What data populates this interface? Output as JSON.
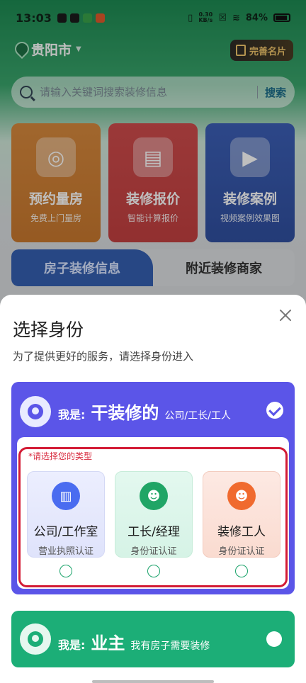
{
  "status": {
    "time": "13:03",
    "net_speed": "0.30",
    "net_unit": "KB/s",
    "battery": "84%"
  },
  "location": {
    "city": "贵阳市"
  },
  "header": {
    "profile_button": "完善名片"
  },
  "search": {
    "placeholder": "请输入关键词搜索装修信息",
    "button": "搜索"
  },
  "services": [
    {
      "title": "预约量房",
      "subtitle": "免费上门量房"
    },
    {
      "title": "装修报价",
      "subtitle": "智能计算报价"
    },
    {
      "title": "装修案例",
      "subtitle": "视频案例效果图"
    }
  ],
  "tabs": [
    {
      "label": "房子装修信息"
    },
    {
      "label": "附近装修商家"
    }
  ],
  "sheet": {
    "title": "选择身份",
    "subtitle": "为了提供更好的服务，请选择身份进入",
    "role_builder": {
      "prefix": "我是:",
      "name": "干装修的",
      "desc": "公司/工长/工人",
      "type_prompt": "*请选择您的类型",
      "options": [
        {
          "label": "公司/工作室",
          "sub": "营业执照认证"
        },
        {
          "label": "工长/经理",
          "sub": "身份证认证"
        },
        {
          "label": "装修工人",
          "sub": "身份证认证"
        }
      ]
    },
    "role_owner": {
      "prefix": "我是:",
      "name": "业主",
      "desc": "我有房子需要装修"
    }
  }
}
